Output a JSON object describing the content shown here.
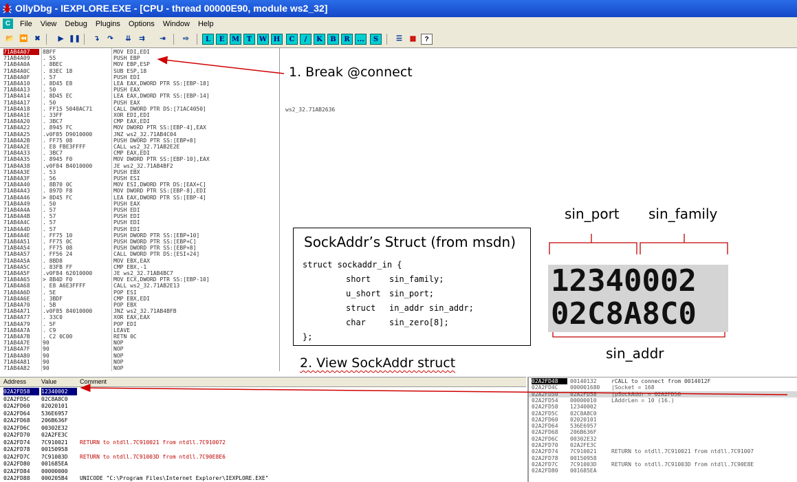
{
  "window": {
    "title": "OllyDbg - IEXPLORE.EXE - [CPU - thread 00000E90, module ws2_32]"
  },
  "menu": {
    "icon_letter": "C",
    "items": [
      "File",
      "View",
      "Debug",
      "Plugins",
      "Options",
      "Window",
      "Help"
    ]
  },
  "toolbar": {
    "letters": [
      "L",
      "E",
      "M",
      "T",
      "W",
      "H",
      "C",
      "/",
      "K",
      "B",
      "R",
      "...",
      "S"
    ]
  },
  "disasm": {
    "rows": [
      [
        "71AB4A07",
        "8BFF",
        "MOV EDI,EDI"
      ],
      [
        "71AB4A09",
        ". 55",
        "PUSH EBP"
      ],
      [
        "71AB4A0A",
        ". 8BEC",
        "MOV EBP,ESP"
      ],
      [
        "71AB4A0C",
        ". 83EC 18",
        "SUB ESP,18"
      ],
      [
        "71AB4A0F",
        ". 57",
        "PUSH EDI"
      ],
      [
        "71AB4A10",
        ". 8D45 E8",
        "LEA EAX,DWORD PTR SS:[EBP-18]"
      ],
      [
        "71AB4A13",
        ". 50",
        "PUSH EAX"
      ],
      [
        "71AB4A14",
        ". 8D45 EC",
        "LEA EAX,DWORD PTR SS:[EBP-14]"
      ],
      [
        "71AB4A17",
        ". 50",
        "PUSH EAX"
      ],
      [
        "71AB4A18",
        ". FF15 5040AC71",
        "CALL DWORD PTR DS:[71AC4050]"
      ],
      [
        "71AB4A1E",
        ". 33FF",
        "XOR EDI,EDI"
      ],
      [
        "71AB4A20",
        ". 3BC7",
        "CMP EAX,EDI"
      ],
      [
        "71AB4A22",
        ". 8945 FC",
        "MOV DWORD PTR SS:[EBP-4],EAX"
      ],
      [
        "71AB4A25",
        ".v0F85 D9010000",
        "JNZ ws2_32.71AB4C04"
      ],
      [
        "71AB4A2B",
        ". FF75 08",
        "PUSH DWORD PTR SS:[EBP+8]"
      ],
      [
        "71AB4A2E",
        ". E8 FBE3FFFF",
        "CALL ws2_32.71AB2E2E"
      ],
      [
        "71AB4A33",
        ". 3BC7",
        "CMP EAX,EDI"
      ],
      [
        "71AB4A35",
        ". 8945 F0",
        "MOV DWORD PTR SS:[EBP-10],EAX"
      ],
      [
        "71AB4A38",
        ".v0F84 B4010000",
        "JE ws2_32.71AB4BF2"
      ],
      [
        "71AB4A3E",
        ". 53",
        "PUSH EBX"
      ],
      [
        "71AB4A3F",
        ". 56",
        "PUSH ESI"
      ],
      [
        "71AB4A40",
        ". 8B70 0C",
        "MOV ESI,DWORD PTR DS:[EAX+C]"
      ],
      [
        "71AB4A43",
        ". 897D F8",
        "MOV DWORD PTR SS:[EBP-8],EDI"
      ],
      [
        "71AB4A46",
        "> 8D45 FC",
        "LEA EAX,DWORD PTR SS:[EBP-4]"
      ],
      [
        "71AB4A49",
        ". 50",
        "PUSH EAX"
      ],
      [
        "71AB4A4A",
        ". 57",
        "PUSH EDI"
      ],
      [
        "71AB4A4B",
        ". 57",
        "PUSH EDI"
      ],
      [
        "71AB4A4C",
        ". 57",
        "PUSH EDI"
      ],
      [
        "71AB4A4D",
        ". 57",
        "PUSH EDI"
      ],
      [
        "71AB4A4E",
        ". FF75 10",
        "PUSH DWORD PTR SS:[EBP+10]"
      ],
      [
        "71AB4A51",
        ". FF75 0C",
        "PUSH DWORD PTR SS:[EBP+C]"
      ],
      [
        "71AB4A54",
        ". FF75 08",
        "PUSH DWORD PTR SS:[EBP+8]"
      ],
      [
        "71AB4A57",
        ". FF56 24",
        "CALL DWORD PTR DS:[ESI+24]"
      ],
      [
        "71AB4A5A",
        ". 8BD8",
        "MOV EBX,EAX"
      ],
      [
        "71AB4A5C",
        ". 83FB FF",
        "CMP EBX,-1"
      ],
      [
        "71AB4A5F",
        ".v0F84 62010000",
        "JE ws2_32.71AB4BC7"
      ],
      [
        "71AB4A65",
        "> 8B4D F0",
        "MOV ECX,DWORD PTR SS:[EBP-10]"
      ],
      [
        "71AB4A68",
        ". E8 A6E3FFFF",
        "CALL ws2_32.71AB2E13"
      ],
      [
        "71AB4A6D",
        ". 5E",
        "POP ESI"
      ],
      [
        "71AB4A6E",
        ". 3BDF",
        "CMP EBX,EDI"
      ],
      [
        "71AB4A70",
        ". 5B",
        "POP EBX"
      ],
      [
        "71AB4A71",
        ".v0F85 84010000",
        "JNZ ws2_32.71AB4BFB"
      ],
      [
        "71AB4A77",
        ". 33C0",
        "XOR EAX,EAX"
      ],
      [
        "71AB4A79",
        ". 5F",
        "POP EDI"
      ],
      [
        "71AB4A7A",
        ". C9",
        "LEAVE"
      ],
      [
        "71AB4A7B",
        ". C2 0C00",
        "RETN 0C"
      ],
      [
        "71AB4A7E",
        "90",
        "NOP"
      ],
      [
        "71AB4A7F",
        "90",
        "NOP"
      ],
      [
        "71AB4A80",
        "90",
        "NOP"
      ],
      [
        "71AB4A81",
        "90",
        "NOP"
      ],
      [
        "71AB4A82",
        "90",
        "NOP"
      ]
    ],
    "comment": "ws2_32.71AB2636"
  },
  "annotations": {
    "break": "1. Break @connect",
    "view": "2. View SockAddr struct",
    "struct_title": "SockAddr’s Struct (from msdn)",
    "struct_lines": [
      [
        "struct sockaddr_in {",
        ""
      ],
      [
        "short",
        "sin_family;"
      ],
      [
        "u_short",
        "sin_port;"
      ],
      [
        "struct",
        "in_addr sin_addr;"
      ],
      [
        "char",
        "sin_zero[8];"
      ],
      [
        "};",
        ""
      ]
    ],
    "sin_port": "sin_port",
    "sin_family": "sin_family",
    "sin_addr": "sin_addr",
    "zoom_line1": "12340002",
    "zoom_line2": "02C8A8C0"
  },
  "dump": {
    "headers": [
      "Address",
      "Value",
      "Comment"
    ],
    "rows": [
      [
        "02A2FD58",
        "12340002",
        ""
      ],
      [
        "02A2FD5C",
        "02C8A8C0",
        ""
      ],
      [
        "02A2FD60",
        "02020101",
        ""
      ],
      [
        "02A2FD64",
        "536E6957",
        ""
      ],
      [
        "02A2FD68",
        "206B636F",
        ""
      ],
      [
        "02A2FD6C",
        "00302E32",
        ""
      ],
      [
        "02A2FD70",
        "02A2FE3C",
        ""
      ],
      [
        "02A2FD74",
        "7C910021",
        "RETURN to ntdll.7C910021 from ntdll.7C910072"
      ],
      [
        "02A2FD78",
        "00150958",
        ""
      ],
      [
        "02A2FD7C",
        "7C91003D",
        "RETURN to ntdll.7C91003D from ntdll.7C90E8E6"
      ],
      [
        "02A2FD80",
        "001685EA",
        ""
      ],
      [
        "02A2FD84",
        "00000000",
        ""
      ],
      [
        "02A2FD88",
        "000205B4",
        "UNICODE \"C:\\Program Files\\Internet Explorer\\IEXPLORE.EXE\""
      ]
    ]
  },
  "stack": {
    "rows": [
      [
        "02A2FD48",
        "00140132",
        "rCALL to connect from 0014012F"
      ],
      [
        "02A2FD4C",
        "000001680",
        "|Socket = 168"
      ],
      [
        "02A2FD50",
        "02A2FD58",
        "|pSockAddr = 02A2FD58"
      ],
      [
        "02A2FD54",
        "00000010",
        "LAddrLen = 10 (16.)"
      ],
      [
        "02A2FD58",
        "12340002",
        ""
      ],
      [
        "02A2FD5C",
        "02C8A8C0",
        ""
      ],
      [
        "02A2FD60",
        "02020101",
        ""
      ],
      [
        "02A2FD64",
        "536E6957",
        ""
      ],
      [
        "02A2FD68",
        "206B636F",
        ""
      ],
      [
        "02A2FD6C",
        "00302E32",
        ""
      ],
      [
        "02A2FD70",
        "02A2FE3C",
        ""
      ],
      [
        "02A2FD74",
        "7C910021",
        "RETURN to ntdll.7C910021 from ntdll.7C91007"
      ],
      [
        "02A2FD78",
        "00150958",
        ""
      ],
      [
        "02A2FD7C",
        "7C91003D",
        "RETURN to ntdll.7C91003D from ntdll.7C90E8E"
      ],
      [
        "02A2FD80",
        "001685EA",
        ""
      ]
    ]
  }
}
